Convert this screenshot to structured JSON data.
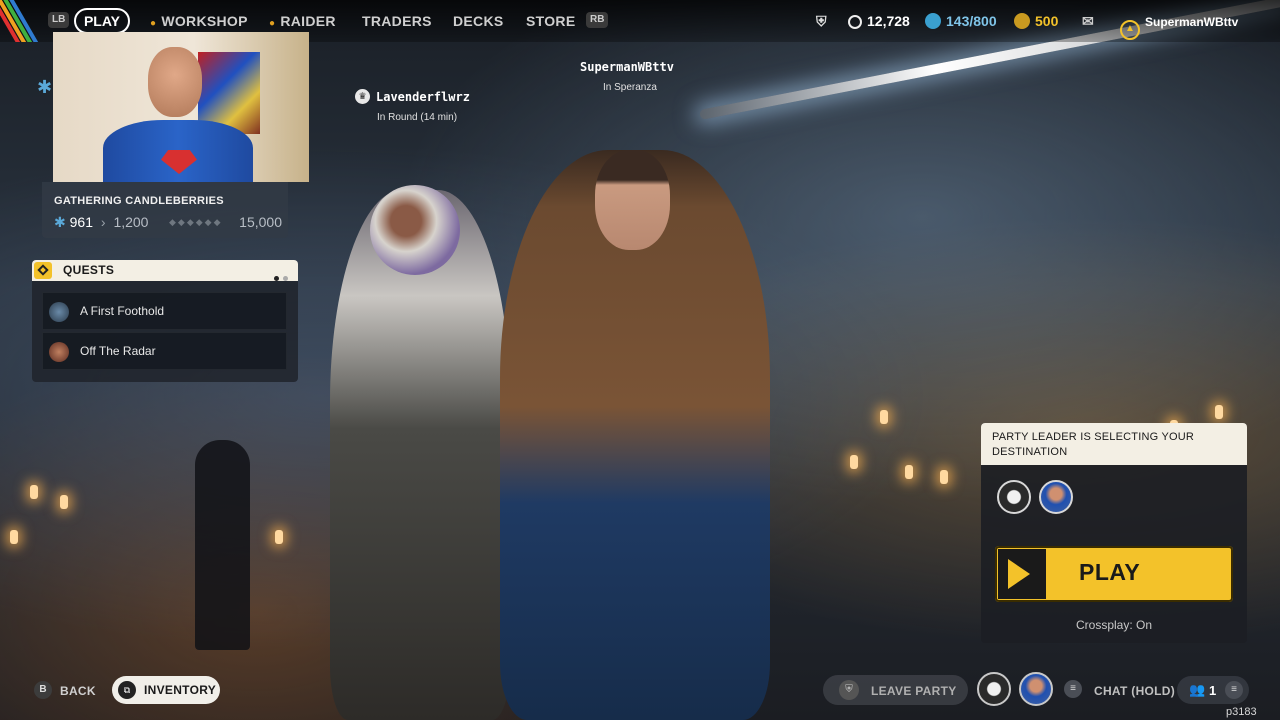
{
  "topnav": {
    "lb": "LB",
    "rb": "RB",
    "items": [
      {
        "label": "PLAY",
        "active": true
      },
      {
        "label": "WORKSHOP"
      },
      {
        "label": "RAIDER"
      },
      {
        "label": "TRADERS"
      },
      {
        "label": "DECKS"
      },
      {
        "label": "STORE"
      }
    ],
    "currency": {
      "raider_coins": "12,728",
      "seeds": "143/800",
      "credits": "500"
    },
    "username": "SupermanWBttv"
  },
  "challenge": {
    "title": "GATHERING CANDLEBERRIES",
    "current": "961",
    "next": "1,200",
    "max": "15,000"
  },
  "quests": {
    "header": "QUESTS",
    "items": [
      {
        "label": "A First Foothold"
      },
      {
        "label": "Off The Radar"
      }
    ]
  },
  "players": {
    "left": {
      "name": "Lavenderflwrz",
      "status": "In Round (14 min)"
    },
    "right": {
      "name": "SupermanWBttv",
      "status": "In Speranza"
    }
  },
  "party": {
    "header": "PARTY LEADER IS SELECTING YOUR DESTINATION",
    "play_label": "PLAY",
    "crossplay": "Crossplay: On"
  },
  "bottom": {
    "back_key": "B",
    "back_label": "BACK",
    "inventory_label": "INVENTORY",
    "leave_party_label": "LEAVE PARTY",
    "chat_label": "CHAT (HOLD)",
    "friends_count": "1",
    "code": "p3183"
  },
  "colors": {
    "accent_yellow": "#f3c22a",
    "panel_cream": "#f3efe4",
    "seeds_blue": "#3aa0d0"
  }
}
